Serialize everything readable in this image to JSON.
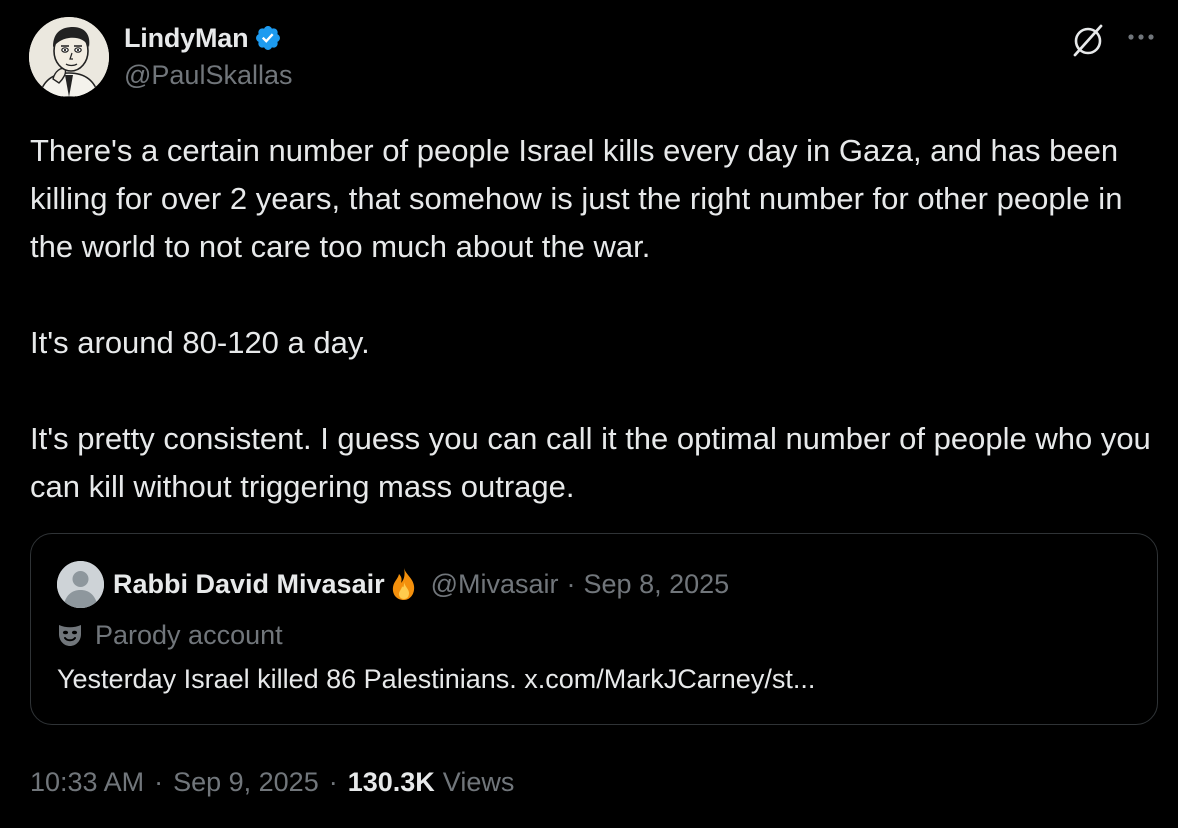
{
  "author": {
    "display_name": "LindyMan",
    "handle": "@PaulSkallas",
    "verified": true,
    "verified_color": "#1d9bf0",
    "avatar_icon": "cartoon-man-avatar"
  },
  "header_actions": {
    "grok_icon": "grok-icon",
    "more_icon": "more-dots-icon"
  },
  "tweet": {
    "paragraphs": [
      "There's a certain number of people Israel kills every day in Gaza, and has been killing for over 2 years, that somehow is just the right number for other people in the world to not care too much about the war.",
      "It's around 80-120 a day.",
      "It's pretty consistent. I guess you can call it the optimal number of people who you can kill without triggering mass outrage."
    ]
  },
  "quote": {
    "display_name": "Rabbi David Mivasair",
    "emoji": "🔥",
    "handle": "@Mivasair",
    "separator": "·",
    "date": "Sep 8, 2025",
    "label": "Parody account",
    "label_icon": "parody-mask-icon",
    "text": "Yesterday Israel killed 86 Palestinians. x.com/MarkJCarney/st..."
  },
  "meta": {
    "time": "10:33 AM",
    "separator": "·",
    "date": "Sep 9, 2025",
    "views_count": "130.3K",
    "views_label": "Views"
  },
  "colors": {
    "background": "#000000",
    "text_primary": "#e7e9ea",
    "text_secondary": "#71767b",
    "border": "#2f3336",
    "accent": "#1d9bf0"
  }
}
